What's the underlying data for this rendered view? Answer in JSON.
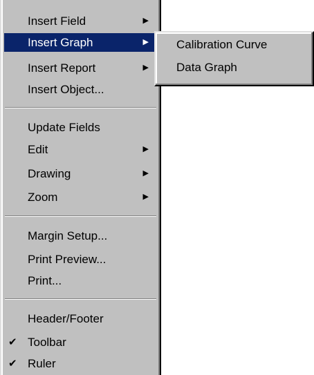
{
  "main_menu": {
    "items": [
      {
        "label": "Insert Field",
        "arrow": "▶"
      },
      {
        "label": "Insert Graph",
        "arrow": "▶"
      },
      {
        "label": "Insert Report",
        "arrow": "▶"
      },
      {
        "label": "Insert Object..."
      },
      {
        "label": "Update Fields"
      },
      {
        "label": "Edit",
        "arrow": "▶"
      },
      {
        "label": "Drawing",
        "arrow": "▶"
      },
      {
        "label": "Zoom",
        "arrow": "▶"
      },
      {
        "label": "Margin Setup..."
      },
      {
        "label": "Print Preview..."
      },
      {
        "label": "Print..."
      },
      {
        "label": "Header/Footer"
      },
      {
        "label": "Toolbar",
        "check": "✔"
      },
      {
        "label": "Ruler",
        "check": "✔"
      }
    ]
  },
  "sub_menu": {
    "items": [
      {
        "label": "Calibration Curve"
      },
      {
        "label": "Data Graph"
      }
    ]
  },
  "colors": {
    "menu_bg": "#c0c0c0",
    "highlight_bg": "#0a246a",
    "highlight_text": "#ffffff"
  }
}
